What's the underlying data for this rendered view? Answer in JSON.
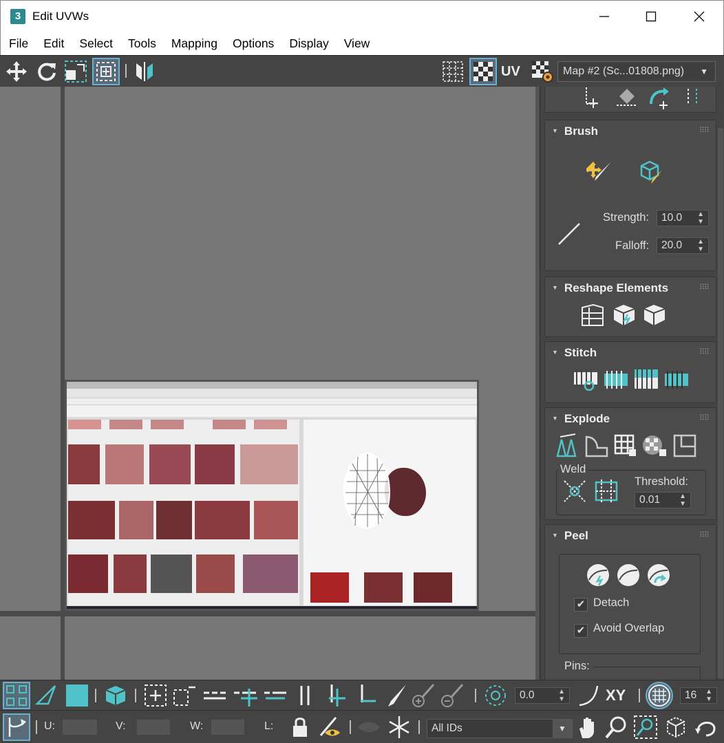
{
  "window": {
    "title": "Edit UVWs",
    "app_icon_label": "3",
    "minimize_icon": "minimize-icon",
    "maximize_icon": "maximize-icon",
    "close_icon": "close-icon"
  },
  "menu": [
    "File",
    "Edit",
    "Select",
    "Tools",
    "Mapping",
    "Options",
    "Display",
    "View"
  ],
  "toolbar": {
    "uv_label": "UV",
    "map_dropdown": "Map #2 (Sc...01808.png)"
  },
  "colors": {
    "accent": "#4fc3c8",
    "select_blue": "#6ab0d0",
    "panel_bg": "#444444",
    "viewport_bg": "#777777"
  },
  "panel": {
    "brush": {
      "title": "Brush",
      "strength_label": "Strength:",
      "strength_value": "10.0",
      "falloff_label": "Falloff:",
      "falloff_value": "20.0"
    },
    "reshape": {
      "title": "Reshape Elements"
    },
    "stitch": {
      "title": "Stitch"
    },
    "explode": {
      "title": "Explode",
      "weld_label": "Weld",
      "threshold_label": "Threshold:",
      "threshold_value": "0.01"
    },
    "peel": {
      "title": "Peel",
      "detach_label": "Detach",
      "detach_checked": true,
      "avoid_overlap_label": "Avoid Overlap",
      "avoid_overlap_checked": true,
      "pins_label": "Pins:"
    }
  },
  "bottom": {
    "rotate_value": "0.0",
    "xy_label": "XY",
    "grid_value": "16",
    "u_label": "U:",
    "v_label": "V:",
    "w_label": "W:",
    "l_label": "L:",
    "ids_dropdown": "All IDs"
  }
}
